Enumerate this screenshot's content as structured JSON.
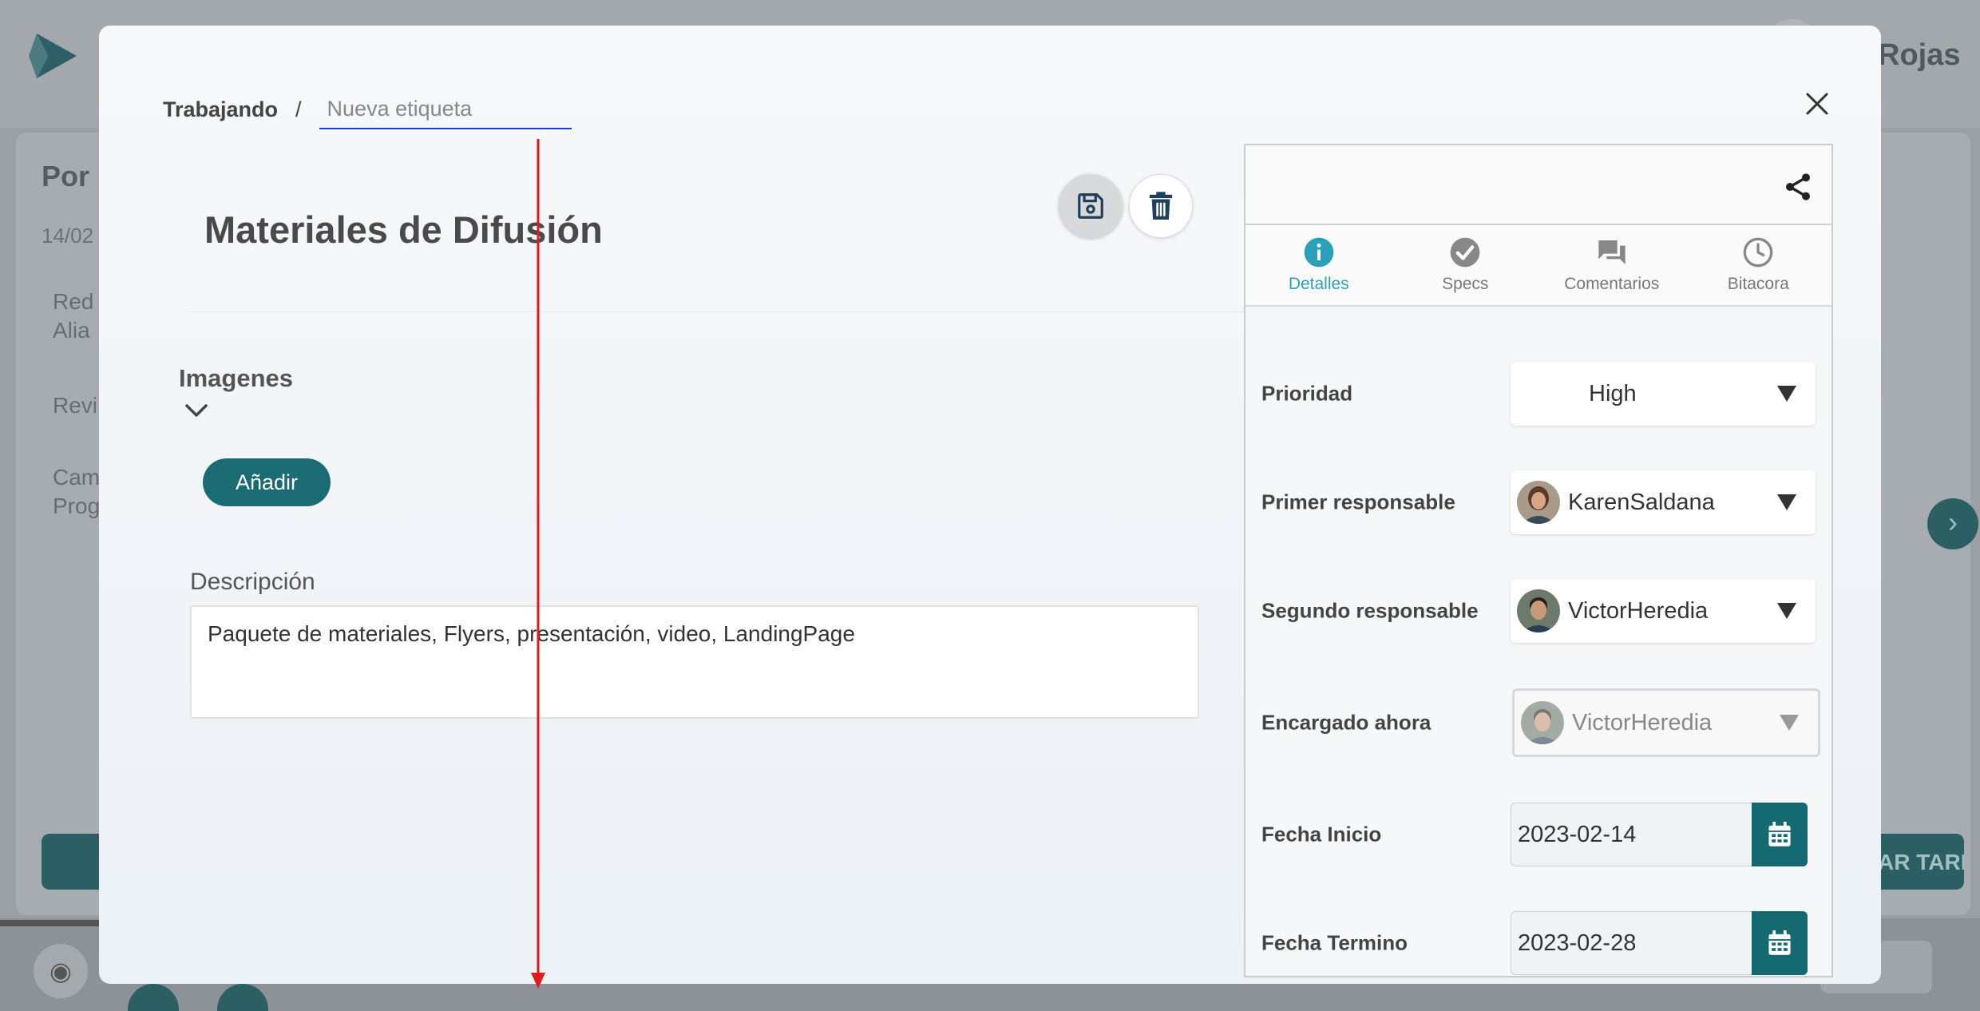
{
  "background": {
    "user_name": "Rojas",
    "column_title": "Por h",
    "column_date": "14/02",
    "items": [
      "Red",
      "Alia",
      "Revi",
      "Cam",
      "Prog"
    ],
    "right_button": "AR TAREA"
  },
  "breadcrumb": {
    "parent": "Trabajando",
    "separator": "/",
    "tag_placeholder": "Nueva etiqueta"
  },
  "task": {
    "title": "Materiales de Difusión",
    "images_label": "Imagenes",
    "add_button": "Añadir",
    "description_label": "Descripción",
    "description_value": "Paquete de materiales, Flyers, presentación, video, LandingPage"
  },
  "panel": {
    "tabs": [
      {
        "label": "Detalles",
        "icon": "info-icon",
        "active": true
      },
      {
        "label": "Specs",
        "icon": "check-circle-icon",
        "active": false
      },
      {
        "label": "Comentarios",
        "icon": "comments-icon",
        "active": false
      },
      {
        "label": "Bitacora",
        "icon": "clock-icon",
        "active": false
      }
    ],
    "fields": {
      "priority": {
        "label": "Prioridad",
        "value": "High"
      },
      "first_owner": {
        "label": "Primer responsable",
        "value": "KarenSaldana"
      },
      "second_owner": {
        "label": "Segundo responsable",
        "value": "VictorHeredia"
      },
      "current_owner": {
        "label": "Encargado ahora",
        "value": "VictorHeredia"
      },
      "start_date": {
        "label": "Fecha Inicio",
        "value": "2023-02-14"
      },
      "end_date": {
        "label": "Fecha Termino",
        "value": "2023-02-28"
      }
    }
  },
  "colors": {
    "accent": "#1a6b73",
    "tab_active": "#2aa1b8",
    "annotation_arrow": "#e01b1b"
  }
}
